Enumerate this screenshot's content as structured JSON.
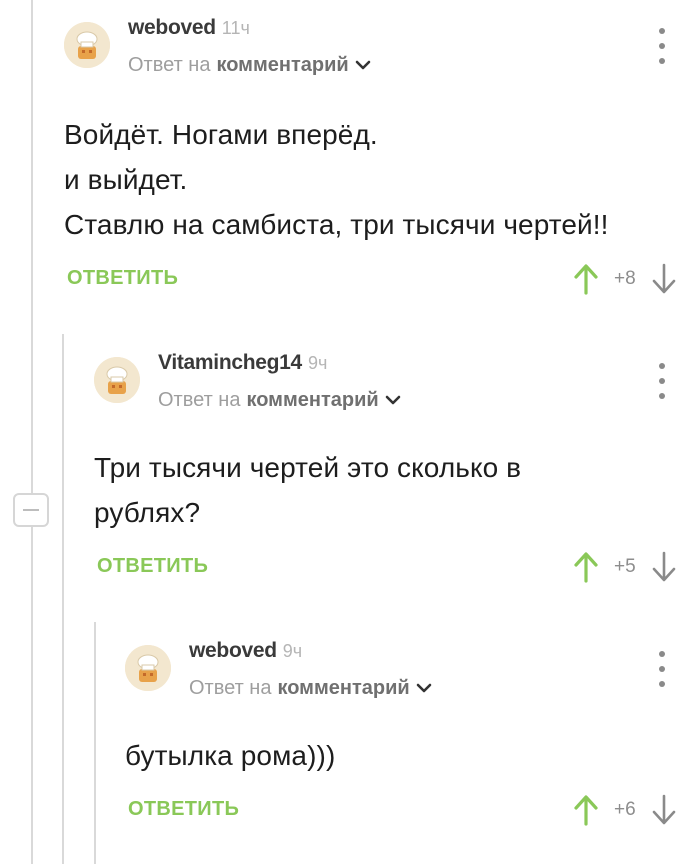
{
  "comments": [
    {
      "author": "weboved",
      "time": "11ч",
      "reply_prefix": "Ответ на",
      "reply_target": "комментарий",
      "lines": [
        "Войдёт. Ногами вперёд.",
        "и выйдет.",
        "Ставлю на самбиста, три тысячи чертей!!"
      ],
      "reply_label": "ОТВЕТИТЬ",
      "score": "+8"
    },
    {
      "author": "Vitamincheg14",
      "time": "9ч",
      "reply_prefix": "Ответ на",
      "reply_target": "комментарий",
      "lines": [
        "Три тысячи чертей это сколько в рублях?"
      ],
      "reply_label": "ОТВЕТИТЬ",
      "score": "+5"
    },
    {
      "author": "weboved",
      "time": "9ч",
      "reply_prefix": "Ответ на",
      "reply_target": "комментарий",
      "lines": [
        "бутылка рома)))"
      ],
      "reply_label": "ОТВЕТИТЬ",
      "score": "+6"
    }
  ],
  "colors": {
    "accent_green": "#8ac858",
    "text": "#1d1d1d",
    "muted": "#9e9e9e",
    "thread_line": "#d9d9d9"
  },
  "icons": {
    "avatar": "chef-hat-avatar-icon",
    "menu": "more-vertical-icon",
    "upvote": "arrow-up-icon",
    "downvote": "arrow-down-icon",
    "dropdown": "chevron-down-icon",
    "collapse": "minus-icon"
  }
}
